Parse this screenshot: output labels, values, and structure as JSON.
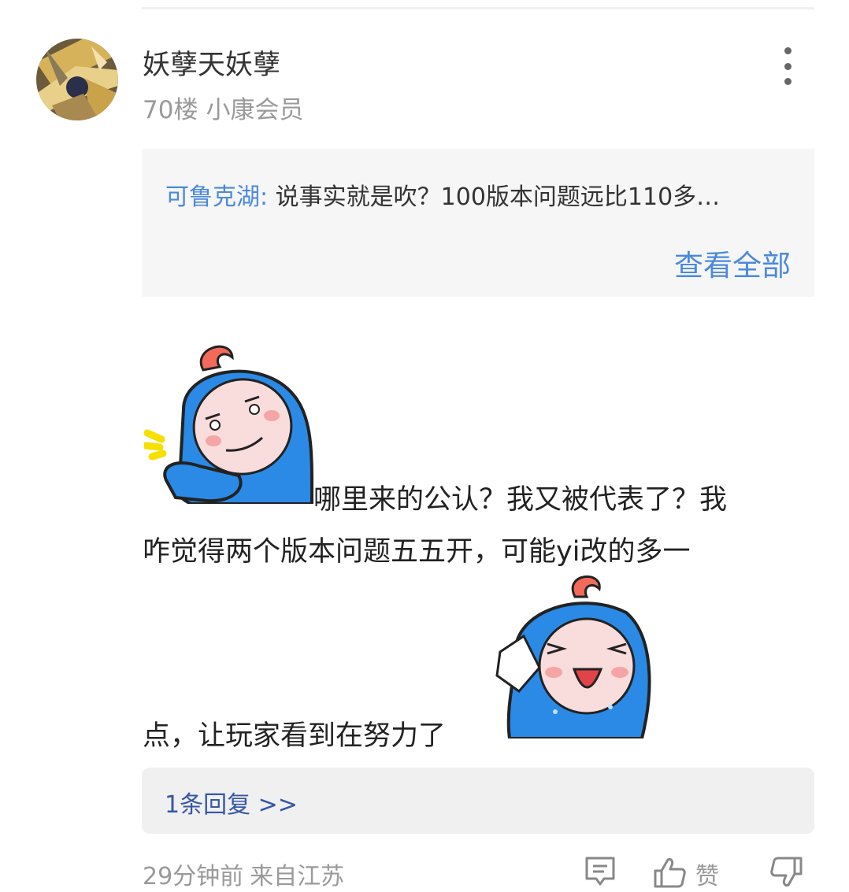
{
  "post": {
    "username": "妖孽天妖孽",
    "floor": "70楼",
    "badge": "小康会员"
  },
  "quote": {
    "author": "可鲁克湖:",
    "text": "说事实就是吹？100版本问题远比110多…",
    "view_all": "查看全部"
  },
  "content": {
    "line1": "哪里来的公认？我又被代表了？我",
    "line2": "咋觉得两个版本问题五五开，可能yi改的多一",
    "line3": "点，让玩家看到在努力了"
  },
  "reply": {
    "label": "1条回复 >>"
  },
  "footer": {
    "time": "29分钟前",
    "location": "来自江苏",
    "like_label": "赞"
  },
  "icons": {
    "more": "more-vertical-icon",
    "comment": "comment-icon",
    "like": "thumbs-up-icon",
    "dislike": "thumbs-down-icon"
  },
  "colors": {
    "link_blue": "#4a89dc",
    "reply_blue": "#3656a8",
    "meta_gray": "#9a9a9a",
    "sticker_blue": "#2a8ae6",
    "sticker_red": "#f26a5a"
  }
}
